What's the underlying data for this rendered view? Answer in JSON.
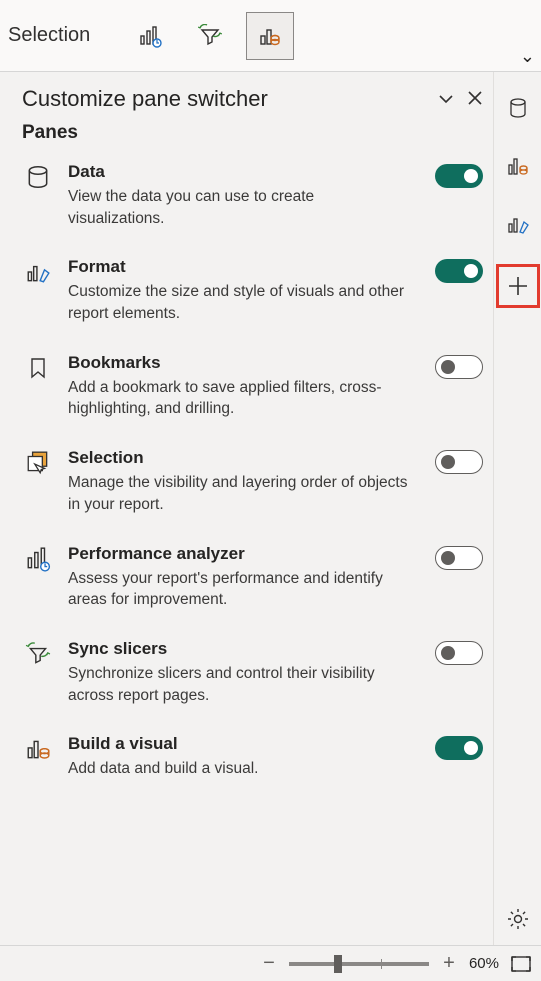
{
  "topbar": {
    "label": "Selection"
  },
  "panel": {
    "title": "Customize pane switcher",
    "subheading": "Panes",
    "items": [
      {
        "title": "Data",
        "desc": "View the data you can use to create visualizations.",
        "on": true
      },
      {
        "title": "Format",
        "desc": "Customize the size and style of visuals and other report elements.",
        "on": true
      },
      {
        "title": "Bookmarks",
        "desc": "Add a bookmark to save applied filters, cross-highlighting, and drilling.",
        "on": false
      },
      {
        "title": "Selection",
        "desc": "Manage the visibility and layering order of objects in your report.",
        "on": false
      },
      {
        "title": "Performance analyzer",
        "desc": "Assess your report's performance and identify areas for improvement.",
        "on": false
      },
      {
        "title": "Sync slicers",
        "desc": "Synchronize slicers and control their visibility across report pages.",
        "on": false
      },
      {
        "title": "Build a visual",
        "desc": "Add data and build a visual.",
        "on": true
      }
    ]
  },
  "zoom": {
    "minus": "−",
    "plus": "+",
    "value": "60%"
  }
}
